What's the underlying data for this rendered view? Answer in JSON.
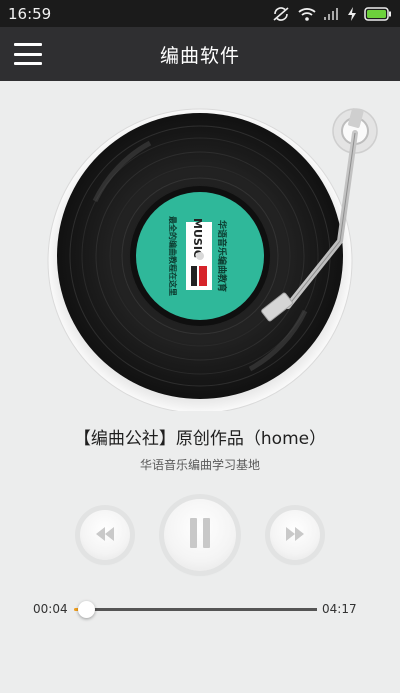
{
  "status_bar": {
    "time": "16:59",
    "icons": [
      "sync-off-icon",
      "wifi-icon",
      "signal-icon",
      "charging-icon",
      "battery-icon"
    ]
  },
  "header": {
    "title": "编曲软件",
    "menu_icon": "hamburger-menu-icon"
  },
  "record": {
    "label_lines": [
      "华语音乐编曲教育",
      "最全的编曲教程在这里",
      "MUSIC"
    ]
  },
  "track": {
    "title": "【编曲公社】原创作品（home）",
    "subtitle": "华语音乐编曲学习基地"
  },
  "controls": {
    "prev_icon": "rewind-icon",
    "play_icon": "pause-icon",
    "next_icon": "fast-forward-icon"
  },
  "progress": {
    "current": "00:04",
    "total": "04:17",
    "fraction": 0.016
  },
  "colors": {
    "header_bg": "#2f2f31",
    "background": "#eceded",
    "record_label": "#2fb89a",
    "progress_played": "#f0a020"
  }
}
